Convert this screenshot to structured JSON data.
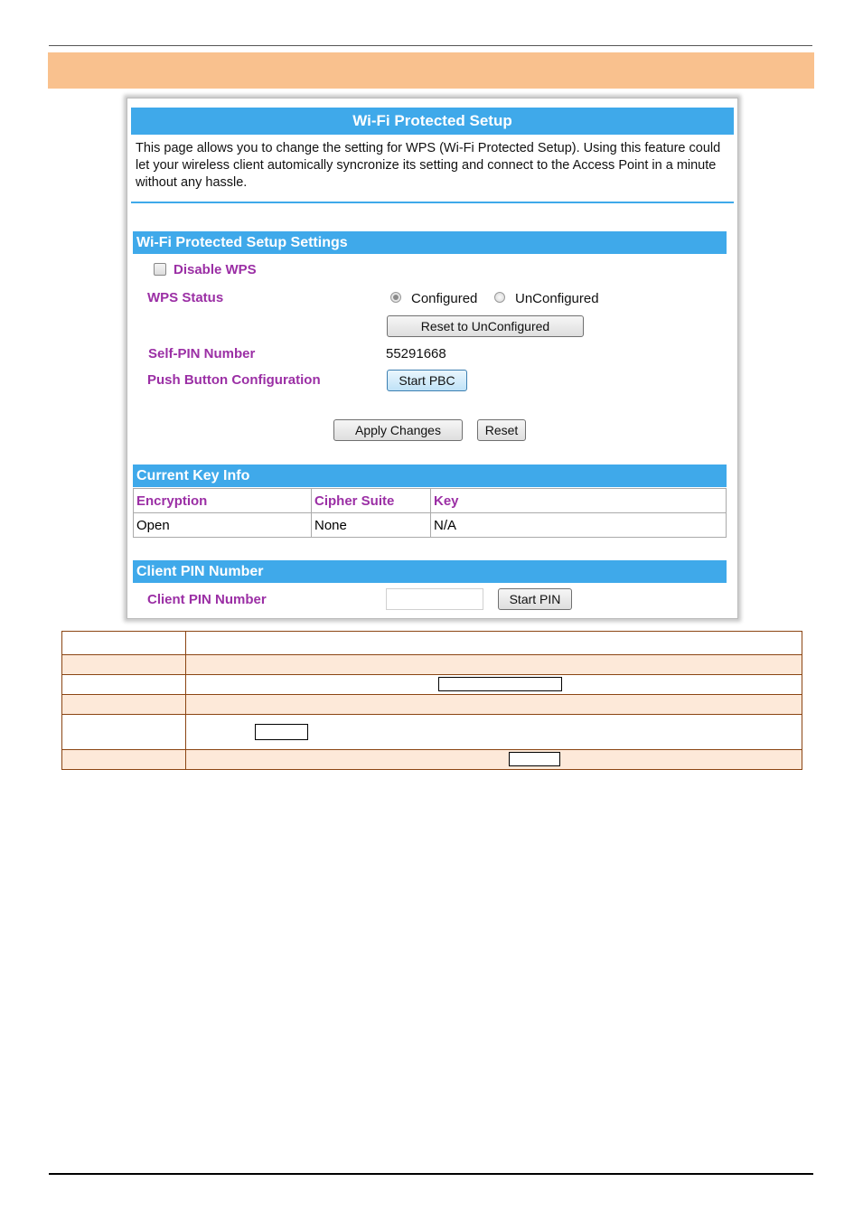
{
  "wps": {
    "title": "Wi-Fi Protected Setup",
    "description": "This page allows you to change the setting for WPS (Wi-Fi Protected Setup). Using this feature could let your wireless client automically syncronize its setting and connect to the Access Point in a minute without any hassle.",
    "settings_header": "Wi-Fi Protected Setup Settings",
    "disable_wps_label": "Disable WPS",
    "disable_wps_checked": false,
    "wps_status_label": "WPS Status",
    "status_configured": "Configured",
    "status_unconfigured": "UnConfigured",
    "status_selected": "Configured",
    "reset_unconfigured_button": "Reset to UnConfigured",
    "self_pin_label": "Self-PIN Number",
    "self_pin_value": "55291668",
    "pbc_label": "Push Button Configuration",
    "start_pbc_button": "Start PBC",
    "apply_button": "Apply Changes",
    "reset_button": "Reset",
    "key_info_header": "Current Key Info",
    "key_table": {
      "headers": [
        "Encryption",
        "Cipher Suite",
        "Key"
      ],
      "rows": [
        [
          "Open",
          "None",
          "N/A"
        ]
      ]
    },
    "client_pin_header": "Client PIN Number",
    "client_pin_label": "Client PIN Number",
    "client_pin_value": "",
    "start_pin_button": "Start PIN"
  },
  "colors": {
    "accent_blue": "#3fa9ea",
    "label_purple": "#9b2fa5",
    "band_orange": "#f9c18e",
    "row_peach": "#fde9d9",
    "table_border": "#8b4513"
  }
}
